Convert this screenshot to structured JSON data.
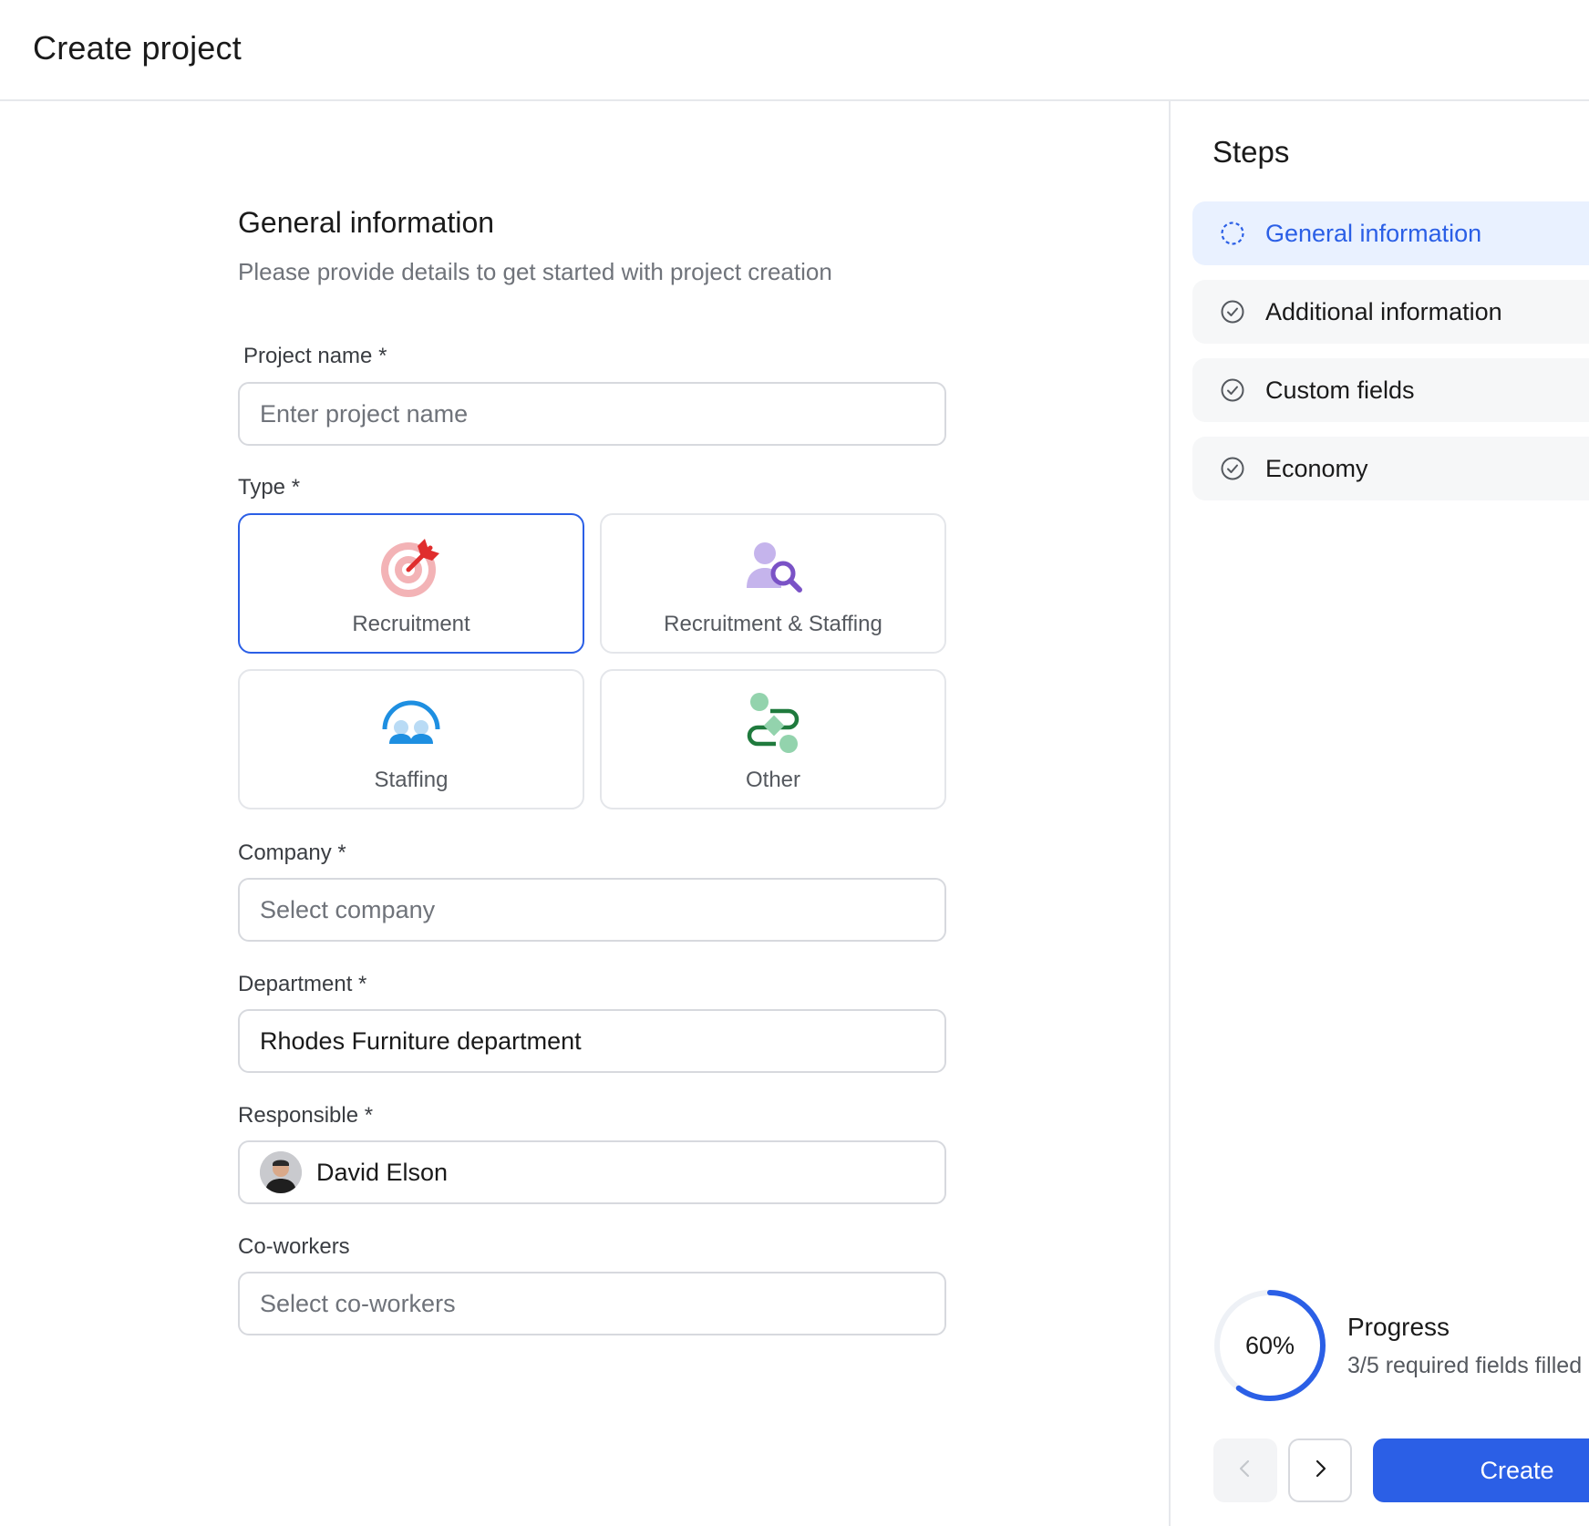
{
  "header": {
    "title": "Create project"
  },
  "form": {
    "section_title": "General information",
    "section_subtitle": "Please provide details to get started with project creation",
    "project_name": {
      "label": "Project name *",
      "placeholder": "Enter project name",
      "value": ""
    },
    "type": {
      "label": "Type *",
      "options": [
        {
          "label": "Recruitment",
          "icon": "target-icon",
          "selected": true
        },
        {
          "label": "Recruitment & Staffing",
          "icon": "person-search-icon",
          "selected": false
        },
        {
          "label": "Staffing",
          "icon": "team-icon",
          "selected": false
        },
        {
          "label": "Other",
          "icon": "flow-icon",
          "selected": false
        }
      ]
    },
    "company": {
      "label": "Company *",
      "placeholder": "Select company",
      "value": ""
    },
    "department": {
      "label": "Department *",
      "value": "Rhodes Furniture department"
    },
    "responsible": {
      "label": "Responsible *",
      "value": "David Elson"
    },
    "coworkers": {
      "label": "Co-workers",
      "placeholder": "Select co-workers",
      "value": ""
    }
  },
  "steps": {
    "title": "Steps",
    "items": [
      {
        "label": "General information",
        "state": "active"
      },
      {
        "label": "Additional information",
        "state": "pending"
      },
      {
        "label": "Custom fields",
        "state": "pending"
      },
      {
        "label": "Economy",
        "state": "pending"
      }
    ]
  },
  "progress": {
    "percent": 60,
    "percent_label": "60%",
    "title": "Progress",
    "subtitle": "3/5 required fields filled"
  },
  "actions": {
    "create_label": "Create"
  },
  "colors": {
    "accent": "#2b5fe6",
    "border": "#d7d9de",
    "active_step_bg": "#e9f1ff"
  }
}
